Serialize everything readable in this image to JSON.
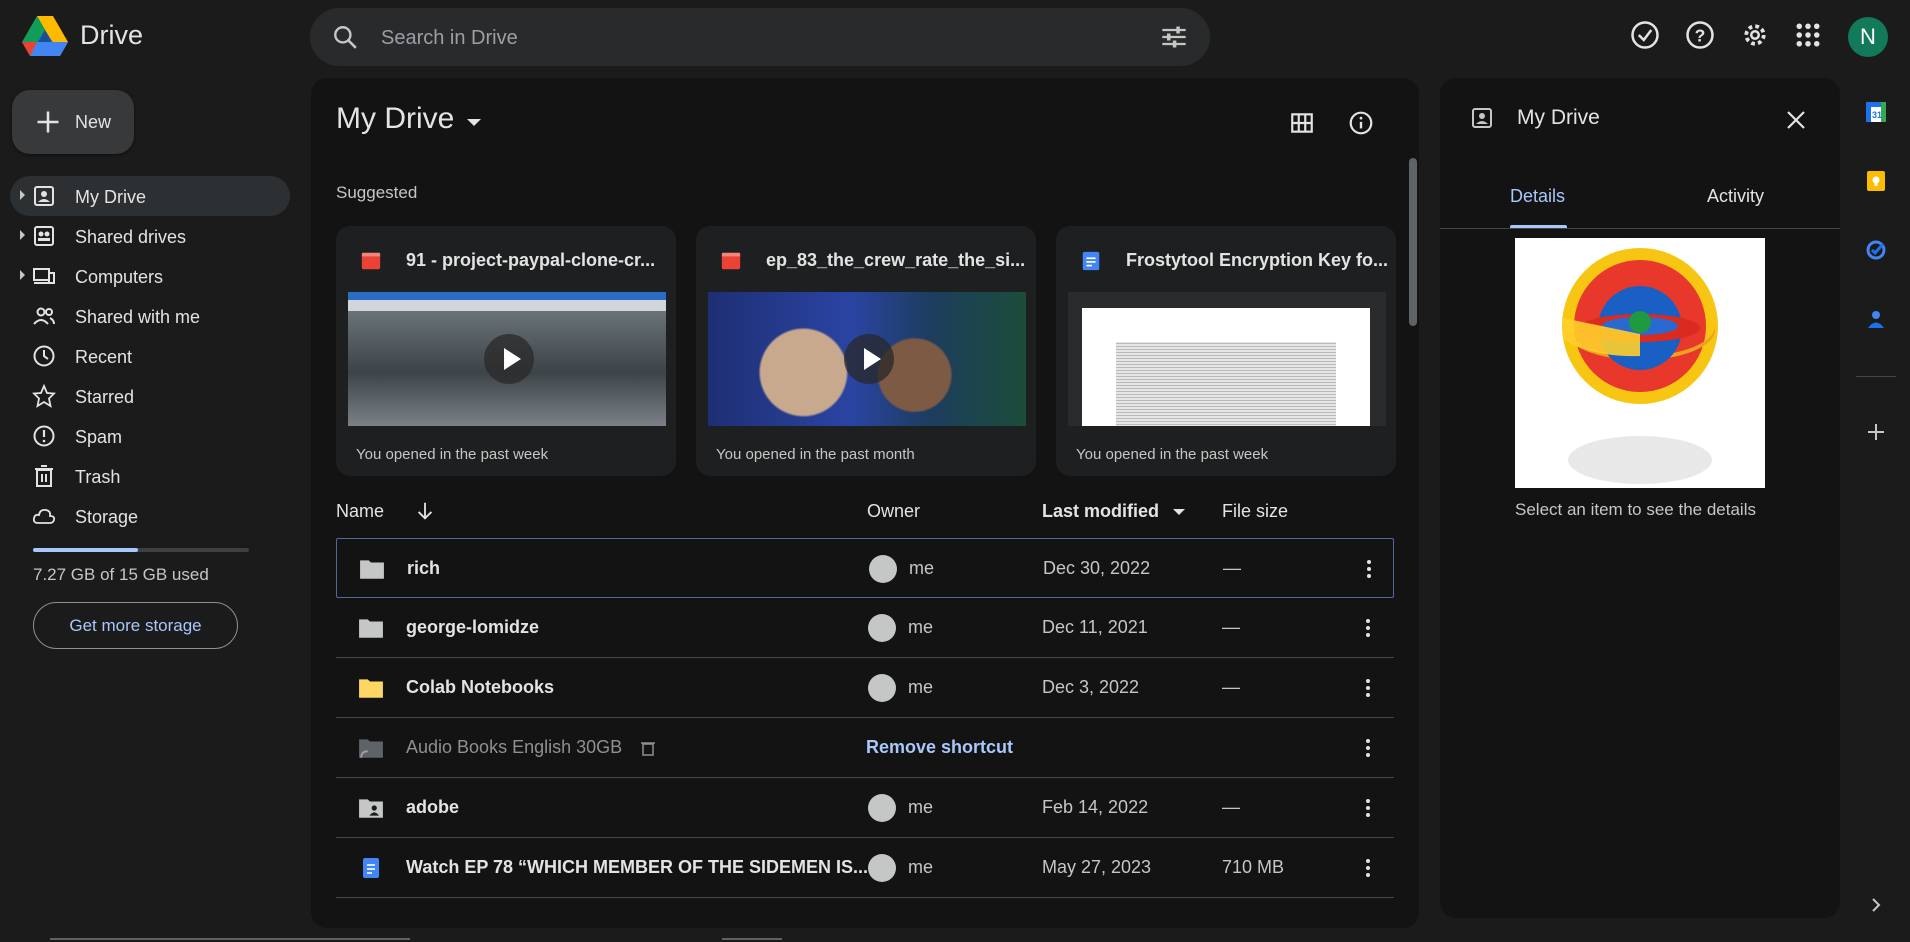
{
  "app": {
    "brand": "Drive"
  },
  "search": {
    "placeholder": "Search in Drive"
  },
  "user": {
    "initial": "N"
  },
  "new_button": {
    "label": "New"
  },
  "sidebar": {
    "items": [
      {
        "label": "My Drive",
        "icon": "my-drive-icon",
        "expandable": true,
        "active": true
      },
      {
        "label": "Shared drives",
        "icon": "shared-drives-icon",
        "expandable": true
      },
      {
        "label": "Computers",
        "icon": "computers-icon",
        "expandable": true
      },
      {
        "label": "Shared with me",
        "icon": "shared-with-me-icon"
      },
      {
        "label": "Recent",
        "icon": "clock-icon"
      },
      {
        "label": "Starred",
        "icon": "star-icon"
      },
      {
        "label": "Spam",
        "icon": "spam-icon"
      },
      {
        "label": "Trash",
        "icon": "trash-icon"
      },
      {
        "label": "Storage",
        "icon": "cloud-icon"
      }
    ],
    "storage_used_fraction": 0.485,
    "storage_text": "7.27 GB of 15 GB used",
    "get_more_label": "Get more storage"
  },
  "main": {
    "title": "My Drive",
    "suggested_label": "Suggested",
    "cards": [
      {
        "title": "91 - project-paypal-clone-cr...",
        "type": "video",
        "footer": "You opened in the past week"
      },
      {
        "title": "ep_83_the_crew_rate_the_si...",
        "type": "video",
        "footer": "You opened in the past month"
      },
      {
        "title": "Frostytool Encryption Key fo...",
        "type": "doc",
        "footer": "You opened in the past week"
      }
    ],
    "columns": {
      "name": "Name",
      "owner": "Owner",
      "modified": "Last modified",
      "size": "File size"
    },
    "rows": [
      {
        "name": "rich",
        "icon": "folder-icon",
        "owner": "me",
        "modified": "Dec 30, 2022",
        "size": "—"
      },
      {
        "name": "george-lomidze",
        "icon": "folder-icon",
        "owner": "me",
        "modified": "Dec 11, 2021",
        "size": "—"
      },
      {
        "name": "Colab Notebooks",
        "icon": "folder-yellow-icon",
        "owner": "me",
        "modified": "Dec 3, 2022",
        "size": "—"
      },
      {
        "name": "Audio Books English 30GB",
        "icon": "shortcut-folder-icon",
        "action": "Remove shortcut"
      },
      {
        "name": "adobe",
        "icon": "shared-folder-icon",
        "owner": "me",
        "modified": "Feb 14, 2022",
        "size": "—"
      },
      {
        "name": "Watch EP 78 “WHICH MEMBER OF THE SIDEMEN IS...",
        "icon": "docs-icon",
        "owner": "me",
        "modified": "May 27, 2023",
        "size": "710 MB"
      }
    ]
  },
  "details": {
    "title": "My Drive",
    "tabs": [
      "Details",
      "Activity"
    ],
    "select_text": "Select an item to see the details"
  },
  "colors": {
    "accent": "#a8c7fa",
    "surface": "#131314",
    "background": "#1b1b1b"
  }
}
